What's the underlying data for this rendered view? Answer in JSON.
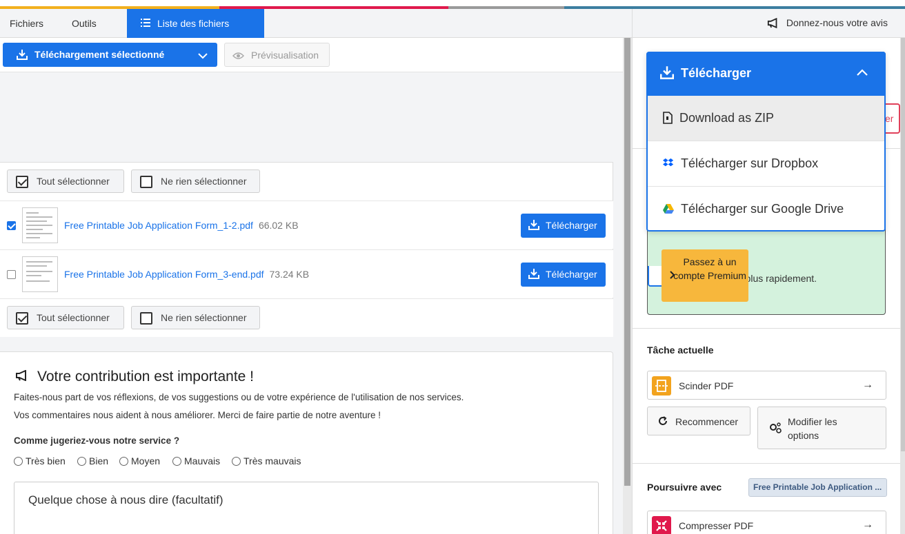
{
  "tabs": {
    "files": "Fichiers",
    "tools": "Outils",
    "file_list": "Liste des fichiers"
  },
  "toolbar": {
    "download_selected": "Téléchargement sélectionné",
    "preview": "Prévisualisation"
  },
  "selection": {
    "select_all": "Tout sélectionner",
    "select_none": "Ne rien sélectionner"
  },
  "files": [
    {
      "name": "Free Printable Job Application Form_1-2.pdf",
      "size": "66.02 KB",
      "checked": true,
      "download_label": "Télécharger"
    },
    {
      "name": "Free Printable Job Application Form_3-end.pdf",
      "size": "73.24 KB",
      "checked": false,
      "download_label": "Télécharger"
    }
  ],
  "feedback": {
    "title": "Votre contribution est importante !",
    "line1": "Faites-nous part de vos réflexions, de vos suggestions ou de votre expérience de l'utilisation de nos services.",
    "line2": "Vos commentaires nous aident à nous améliorer. Merci de faire partie de notre aventure !",
    "question": "Comme jugeriez-vous notre service ?",
    "options": [
      "Très bien",
      "Bien",
      "Moyen",
      "Mauvais",
      "Très mauvais"
    ],
    "textarea_placeholder": "Quelque chose à nous dire (facultatif)"
  },
  "right": {
    "feedback_link": "Donnez-nous votre avis",
    "promo_text": "rs plus rapidement.",
    "premium_button": "Passez à un compte Premium",
    "red_stub": "er",
    "current_task_title": "Tâche actuelle",
    "current_task": "Scinder PDF",
    "restart": "Recommencer",
    "modify_options": "Modifier les options",
    "continue_title": "Poursuivre avec",
    "continue_chip": "Free Printable Job Application ...",
    "next_task": "Compresser PDF"
  },
  "dropdown": {
    "header": "Télécharger",
    "items": [
      "Download as ZIP",
      "Télécharger sur Dropbox",
      "Télécharger sur Google Drive"
    ]
  },
  "colors": {
    "accent": "#1a73e8",
    "premium": "#f7b73c",
    "promo_bg": "#d4f2dd"
  }
}
